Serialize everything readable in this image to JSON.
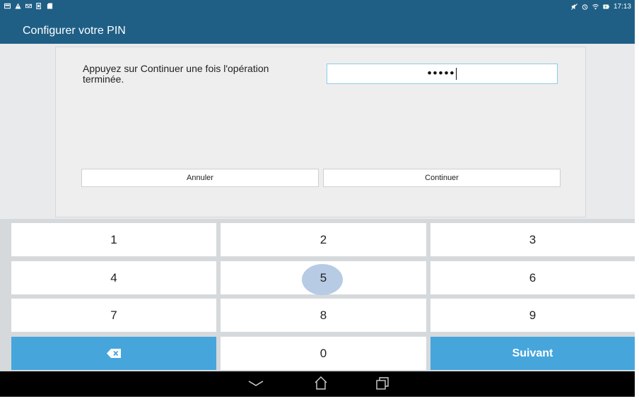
{
  "status_bar": {
    "time": "17:13",
    "left_icons": [
      "image-icon",
      "warning-icon",
      "envelope-icon",
      "sim-icon",
      "sd-card-icon"
    ],
    "right_icons": [
      "mute-icon",
      "alarm-icon",
      "wifi-icon",
      "battery-charging-icon"
    ]
  },
  "action_bar": {
    "title": "Configurer votre PIN"
  },
  "dialog": {
    "instruction": "Appuyez sur Continuer une fois l'opération terminée.",
    "pin_value": "•••••",
    "cancel_label": "Annuler",
    "continue_label": "Continuer"
  },
  "keypad": {
    "keys": [
      "1",
      "2",
      "3",
      "4",
      "5",
      "6",
      "7",
      "8",
      "9",
      "0"
    ],
    "next_label": "Suivant",
    "pressed_key": "5"
  },
  "nav_bar": {
    "icons": [
      "back-icon",
      "home-icon",
      "recent-apps-icon"
    ]
  },
  "colors": {
    "status_bar": "#1f5f86",
    "accent_key": "#46a6dc",
    "pressed_highlight": "#b8cbe4",
    "field_focus_border": "#8ecbe8"
  }
}
